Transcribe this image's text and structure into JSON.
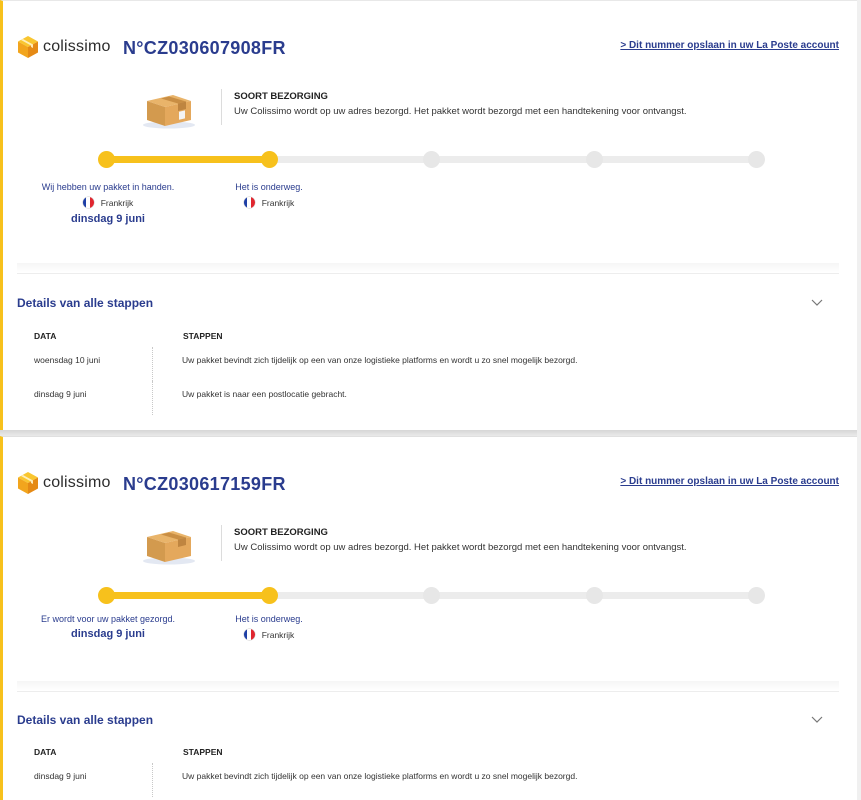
{
  "brand": {
    "name": "colissimo",
    "accent_color": "#f7c11c",
    "link_color": "#2a3c8e"
  },
  "shipments": [
    {
      "tracking_number": "N°CZ030607908FR",
      "save_link": "> Dit nummer opslaan in uw La Poste account",
      "delivery_type_title": "SOORT BEZORGING",
      "delivery_type_desc": "Uw Colissimo wordt op uw adres bezorgd. Het pakket wordt bezorgd met een handtekening voor ontvangst.",
      "progress_completed_steps": 2,
      "progress_total_steps": 5,
      "steps": [
        {
          "label": "Wij hebben uw pakket in handen.",
          "country": "Frankrijk",
          "date": "dinsdag 9 juni"
        },
        {
          "label": "Het is onderweg.",
          "country": "Frankrijk",
          "date": ""
        }
      ],
      "details_title": "Details van alle stappen",
      "table_headers": {
        "date": "DATA",
        "steps": "STAPPEN"
      },
      "events": [
        {
          "date": "woensdag 10 juni",
          "description": "Uw pakket bevindt zich tijdelijk op een van onze logistieke platforms en wordt u zo snel mogelijk bezorgd."
        },
        {
          "date": "dinsdag 9 juni",
          "description": "Uw pakket is naar een postlocatie gebracht."
        }
      ]
    },
    {
      "tracking_number": "N°CZ030617159FR",
      "save_link": "> Dit nummer opslaan in uw La Poste account",
      "delivery_type_title": "SOORT BEZORGING",
      "delivery_type_desc": "Uw Colissimo wordt op uw adres bezorgd. Het pakket wordt bezorgd met een handtekening voor ontvangst.",
      "progress_completed_steps": 2,
      "progress_total_steps": 5,
      "steps": [
        {
          "label": "Er wordt voor uw pakket gezorgd.",
          "country": "",
          "date": "dinsdag 9 juni"
        },
        {
          "label": "Het is onderweg.",
          "country": "Frankrijk",
          "date": ""
        }
      ],
      "details_title": "Details van alle stappen",
      "table_headers": {
        "date": "DATA",
        "steps": "STAPPEN"
      },
      "events": [
        {
          "date": "dinsdag 9 juni",
          "description": "Uw pakket bevindt zich tijdelijk op een van onze logistieke platforms en wordt u zo snel mogelijk bezorgd."
        }
      ]
    }
  ]
}
